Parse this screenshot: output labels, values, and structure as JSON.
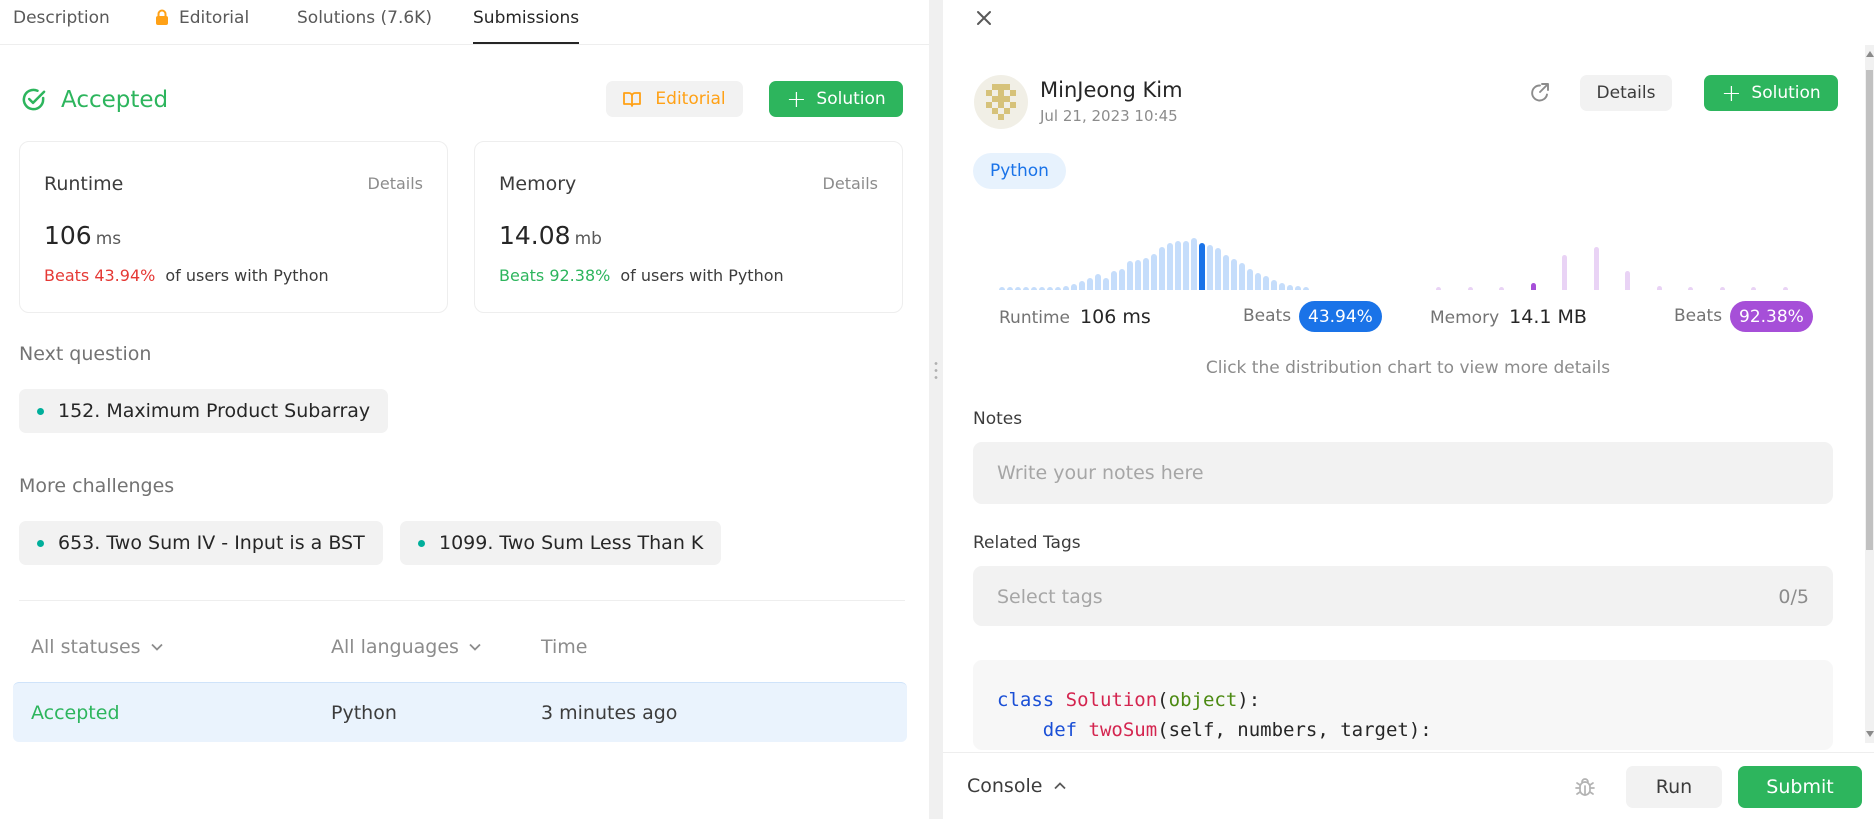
{
  "tabs": [
    {
      "label": "Description"
    },
    {
      "label": "Editorial",
      "locked": true
    },
    {
      "label": "Solutions (7.6K)"
    },
    {
      "label": "Submissions",
      "active": true
    }
  ],
  "result": {
    "status": "Accepted",
    "editorial_label": "Editorial",
    "solution_label": "Solution"
  },
  "runtime_card": {
    "title": "Runtime",
    "details": "Details",
    "value": "106",
    "unit": "ms",
    "beats": "Beats 43.94%",
    "suffix": "of users with Python"
  },
  "memory_card": {
    "title": "Memory",
    "details": "Details",
    "value": "14.08",
    "unit": "mb",
    "beats": "Beats 92.38%",
    "suffix": "of users with Python"
  },
  "next_question": {
    "label": "Next question",
    "item": "152. Maximum Product Subarray"
  },
  "more_challenges": {
    "label": "More challenges",
    "items": [
      "653. Two Sum IV - Input is a BST",
      "1099. Two Sum Less Than K"
    ]
  },
  "submissions_table": {
    "filters": {
      "status": "All statuses",
      "language": "All languages",
      "time": "Time"
    },
    "rows": [
      {
        "status": "Accepted",
        "language": "Python",
        "time": "3 minutes ago"
      }
    ]
  },
  "detail": {
    "user": "MinJeong Kim",
    "date": "Jul 21, 2023 10:45",
    "details_label": "Details",
    "solution_label": "Solution",
    "language": "Python",
    "runtime": {
      "label": "Runtime",
      "value": "106 ms",
      "beats_label": "Beats",
      "beats_pct": "43.94%",
      "distribution": [
        0.06,
        0.06,
        0.06,
        0.06,
        0.06,
        0.06,
        0.06,
        0.06,
        0.08,
        0.12,
        0.17,
        0.23,
        0.3,
        0.23,
        0.36,
        0.4,
        0.55,
        0.58,
        0.62,
        0.7,
        0.82,
        0.9,
        0.94,
        0.94,
        1.0,
        0.9,
        0.86,
        0.8,
        0.68,
        0.6,
        0.52,
        0.4,
        0.32,
        0.26,
        0.2,
        0.14,
        0.09,
        0.07,
        0.06
      ],
      "highlight_index": 25,
      "color": "#c5ddfb",
      "highlight_color": "#1a73e8"
    },
    "memory": {
      "label": "Memory",
      "value": "14.1 MB",
      "beats_label": "Beats",
      "beats_pct": "92.38%",
      "distribution": [
        0.06,
        0.06,
        0.06,
        0.14,
        0.68,
        0.82,
        0.36,
        0.08,
        0.06,
        0.06,
        0.06,
        0.06
      ],
      "highlight_index": 3,
      "color": "#e9d3f5",
      "highlight_color": "#a64fd8"
    },
    "hint": "Click the distribution chart to view more details",
    "notes_label": "Notes",
    "notes_placeholder": "Write your notes here",
    "tags_label": "Related Tags",
    "tags_placeholder": "Select tags",
    "tags_count": "0/5",
    "code": {
      "line1": {
        "kw": "class",
        "name": "Solution",
        "open": "(",
        "base": "object",
        "close": "):"
      },
      "line2": {
        "indent": "    ",
        "kw": "def",
        "name": "twoSum",
        "args": "(self, numbers, target):"
      }
    }
  },
  "console": {
    "label": "Console",
    "run_label": "Run",
    "submit_label": "Submit"
  },
  "colors": {
    "accent_green": "#2db55d",
    "editorial_orange": "#ffa116",
    "runtime_blue": "#1a73e8",
    "memory_purple": "#a64fd8",
    "beats_red": "#e53935"
  }
}
